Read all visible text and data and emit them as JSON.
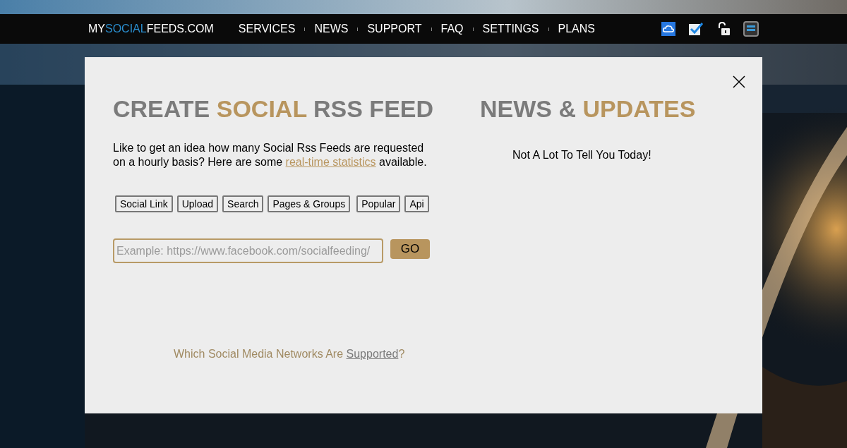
{
  "nav": {
    "logo": [
      {
        "text": "MY",
        "accent": false
      },
      {
        "text": "SOCIAL",
        "accent": true
      },
      {
        "text": "FEEDS.COM",
        "accent": false
      }
    ],
    "links": [
      "SERVICES",
      "NEWS",
      "SUPPORT",
      "FAQ",
      "SETTINGS",
      "PLANS"
    ],
    "icons": [
      {
        "kind": "cloud"
      },
      {
        "kind": "check"
      },
      {
        "kind": "lock"
      },
      {
        "kind": "menu"
      }
    ]
  },
  "create": {
    "heading": [
      {
        "text": "CREATE ",
        "accent": false
      },
      {
        "text": "SOCIAL",
        "accent": true
      },
      {
        "text": " RSS FEED",
        "accent": false
      }
    ],
    "intro": {
      "before": "Like to get an idea how many Social Rss Feeds are requested on a hourly basis? Here are some ",
      "link": "real-time statistics",
      "after": " available."
    },
    "tabs": [
      "Social Link",
      "Upload",
      "Search",
      "Pages & Groups",
      "Popular",
      "Api"
    ],
    "url_field": {
      "placeholder": "Example: https://www.facebook.com/socialfeeding/"
    },
    "go_button": "GO",
    "footer": {
      "before": "Which Social Media Networks Are ",
      "link": "Supported",
      "after": "?"
    }
  },
  "news": {
    "heading": [
      {
        "text": "NEWS & ",
        "accent": false
      },
      {
        "text": "UPDATES",
        "accent": true
      }
    ],
    "message": "Not A Lot To Tell You Today!"
  }
}
